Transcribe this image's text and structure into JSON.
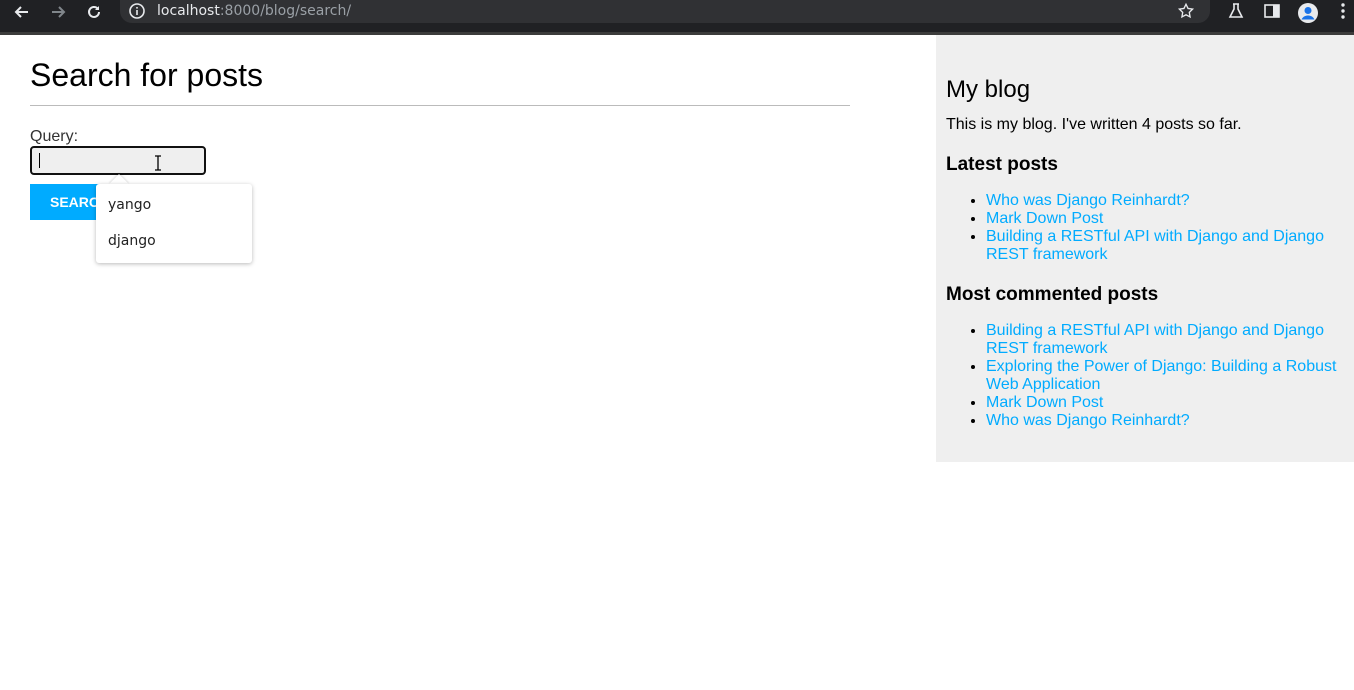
{
  "browser": {
    "url_host": "localhost",
    "url_rest": ":8000/blog/search/"
  },
  "page": {
    "title": "Search for posts",
    "query_label": "Query:",
    "query_value": "",
    "search_button": "SEARCH"
  },
  "autocomplete": {
    "items": [
      {
        "label": "yango"
      },
      {
        "label": "django"
      }
    ]
  },
  "sidebar": {
    "title": "My blog",
    "intro": "This is my blog. I've written 4 posts so far.",
    "latest_heading": "Latest posts",
    "latest": [
      {
        "label": "Who was Django Reinhardt?"
      },
      {
        "label": "Mark Down Post"
      },
      {
        "label": "Building a RESTful API with Django and Django REST framework"
      }
    ],
    "commented_heading": "Most commented posts",
    "commented": [
      {
        "label": "Building a RESTful API with Django and Django REST framework"
      },
      {
        "label": "Exploring the Power of Django: Building a Robust Web Application"
      },
      {
        "label": "Mark Down Post"
      },
      {
        "label": "Who was Django Reinhardt?"
      }
    ]
  },
  "colors": {
    "accent": "#00abff",
    "sidebar_bg": "#efefef",
    "chrome_bg": "#202124"
  }
}
